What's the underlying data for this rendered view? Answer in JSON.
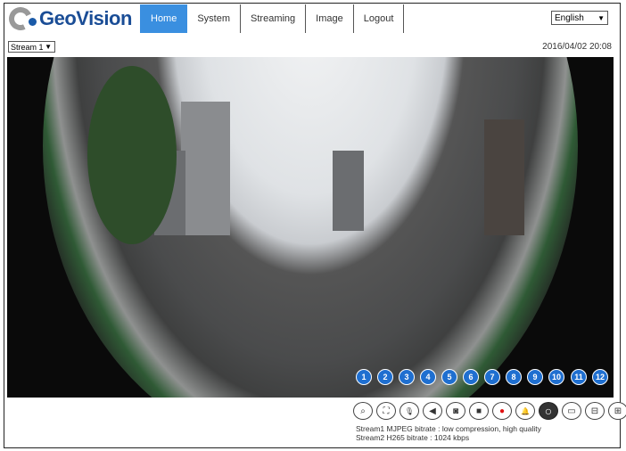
{
  "brand": "GeoVision",
  "nav": [
    "Home",
    "System",
    "Streaming",
    "Image",
    "Logout"
  ],
  "language": "English",
  "stream_select": "Stream 1",
  "datetime": "2016/04/02 20:08",
  "controls": [
    {
      "num": "1",
      "icon": "ptz-camera-icon",
      "glyph": "⌕"
    },
    {
      "num": "2",
      "icon": "fullscreen-icon",
      "glyph": "⛶"
    },
    {
      "num": "3",
      "icon": "microphone-icon",
      "glyph": "🎙"
    },
    {
      "num": "4",
      "icon": "speaker-icon",
      "glyph": "◀"
    },
    {
      "num": "5",
      "icon": "snapshot-camera-icon",
      "glyph": "◙"
    },
    {
      "num": "6",
      "icon": "stop-icon",
      "glyph": "■"
    },
    {
      "num": "7",
      "icon": "record-icon",
      "glyph": "●"
    },
    {
      "num": "8",
      "icon": "alarm-bell-icon",
      "glyph": "🔔"
    },
    {
      "num": "9",
      "icon": "fisheye-view-icon",
      "glyph": "○"
    },
    {
      "num": "10",
      "icon": "single-view-icon",
      "glyph": "▭"
    },
    {
      "num": "11",
      "icon": "panorama-view-icon",
      "glyph": "⊟"
    },
    {
      "num": "12",
      "icon": "quad-view-icon",
      "glyph": "⊞"
    }
  ],
  "info": [
    "Stream1 MJPEG bitrate : low compression, high quality",
    "Stream2 H265 bitrate : 1024 kbps"
  ],
  "colors": {
    "accent": "#3a8fe0",
    "badge": "#1f6fd0",
    "record": "#e01010"
  }
}
